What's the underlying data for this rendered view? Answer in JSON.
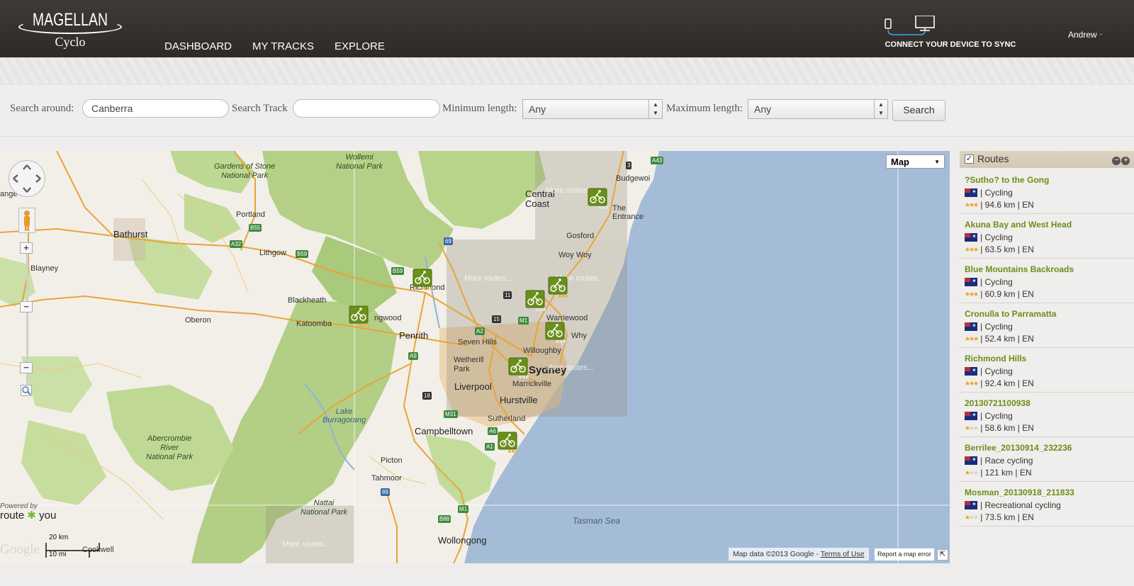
{
  "header": {
    "logo_brand": "MAGELLAN",
    "logo_sub": "Cyclo",
    "nav": [
      "DASHBOARD",
      "MY TRACKS",
      "EXPLORE"
    ],
    "sync_label": "CONNECT YOUR DEVICE TO SYNC",
    "user": "Andrew"
  },
  "search": {
    "around_label": "Search around:",
    "around_value": "Canberra",
    "track_label": "Search Track",
    "track_value": "",
    "min_label": "Minimum length:",
    "min_value": "Any",
    "max_label": "Maximum length:",
    "max_value": "Any",
    "button": "Search"
  },
  "map": {
    "type_selector": "Map",
    "attribution": "Map data ©2013 Google -",
    "terms": "Terms of Use",
    "report": "Report a map error",
    "powered_by": "Powered by",
    "routeyou": "route",
    "routeyou2": "you",
    "google": "Google",
    "scale_km": "20 km",
    "scale_mi": "10 mi",
    "more_routes": "More routes...",
    "labels": {
      "gardens": "Gardens of Stone\nNational Park",
      "wollemi": "Wollemi\nNational Park",
      "budgewoi": "Budgewoi",
      "central_coast": "Central\nCoast",
      "the_entrance": "The\nEntrance",
      "gosford": "Gosford",
      "woy_woy": "Woy Woy",
      "portland": "Portland",
      "bathurst": "Bathurst",
      "lithgow": "Lithgow",
      "blayney": "Blayney",
      "richmond": "Richmond",
      "blackheath": "Blackheath",
      "katoomba": "Katoomba",
      "oberon": "Oberon",
      "springwood": "ngwood",
      "penrith": "Penrith",
      "warriewood": "Warriewood",
      "why": "Why",
      "seven_hills": "Seven Hills",
      "willoughby": "Willoughby",
      "wetherill": "Wetherill\nPark",
      "sydney": "Sydney",
      "liverpool": "Liverpool",
      "marrickville": "Marrickville",
      "hurstville": "Hurstville",
      "lake_burragorang": "Lake\nBurragorang",
      "sutherland": "Sutherland",
      "campbelltown": "Campbelltown",
      "abercrombie": "Abercrombie\nRiver\nNational Park",
      "picton": "Picton",
      "tahmoor": "Tahmoor",
      "nattai": "Nattai\nNational Park",
      "tasman_sea": "Tasman Sea",
      "wollongong": "Wollongong",
      "cookwell": "Cookwell",
      "range": "ange"
    },
    "roads": [
      "A43",
      "3",
      "B55",
      "A32",
      "B59",
      "69",
      "B59",
      "11",
      "15",
      "M1",
      "A2",
      "A9",
      "18",
      "M31",
      "A6",
      "A1",
      "89",
      "M1",
      "B88"
    ]
  },
  "routes": {
    "title": "Routes",
    "items": [
      {
        "name": "?Sutho? to the Gong",
        "type": "| Cycling",
        "stats": "| 94.6 km | EN",
        "stars": 3
      },
      {
        "name": "Akuna Bay and West Head",
        "type": "| Cycling",
        "stats": "| 63.5 km | EN",
        "stars": 3
      },
      {
        "name": "Blue Mountains Backroads",
        "type": "| Cycling",
        "stats": "| 60.9 km | EN",
        "stars": 3
      },
      {
        "name": "Cronulla to Parramatta",
        "type": "| Cycling",
        "stats": "| 52.4 km | EN",
        "stars": 3
      },
      {
        "name": "Richmond Hills",
        "type": "| Cycling",
        "stats": "| 92.4 km | EN",
        "stars": 3
      },
      {
        "name": "20130721100938",
        "type": "| Cycling",
        "stats": "| 58.6 km | EN",
        "stars": 1
      },
      {
        "name": "Berrilee_20130914_232236",
        "type": "| Race cycling",
        "stats": "| 121 km | EN",
        "stars": 1
      },
      {
        "name": "Mosman_20130918_211833",
        "type": "| Recreational cycling",
        "stats": "| 73.5 km | EN",
        "stars": 1
      }
    ]
  },
  "colors": {
    "header_bg": "#2e2a26",
    "route_name": "#6d8d1b",
    "sea": "#a5bcd8",
    "land": "#f2efe8",
    "park": "#b4d087",
    "road": "#e9a437"
  }
}
